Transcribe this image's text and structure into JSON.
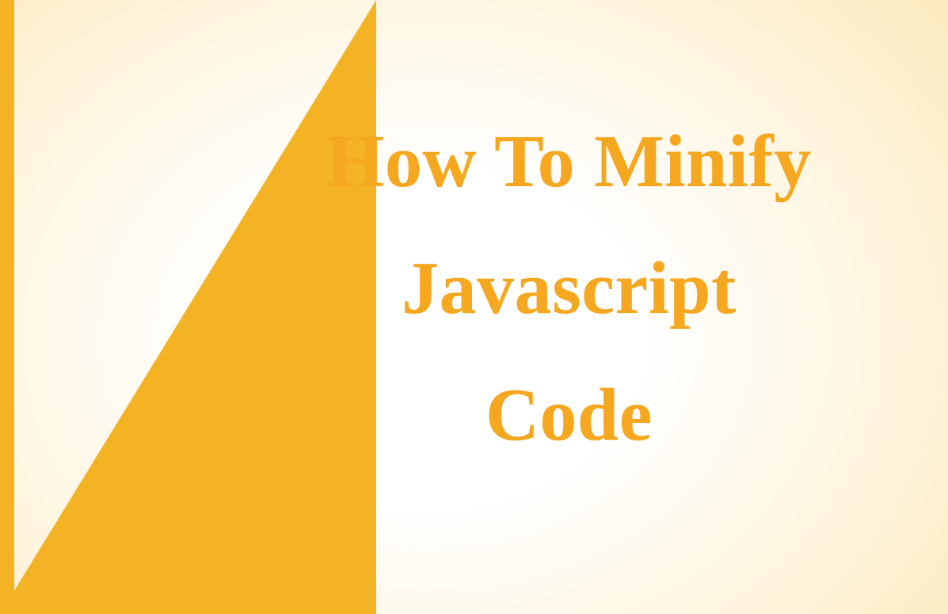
{
  "title": {
    "line1": "How To Minify",
    "line2": "Javascript",
    "line3": "Code"
  },
  "colors": {
    "accent": "#f4b324",
    "text": "#f4a71f",
    "background_light": "#ffffff",
    "background_warm": "#fbe8b8"
  }
}
